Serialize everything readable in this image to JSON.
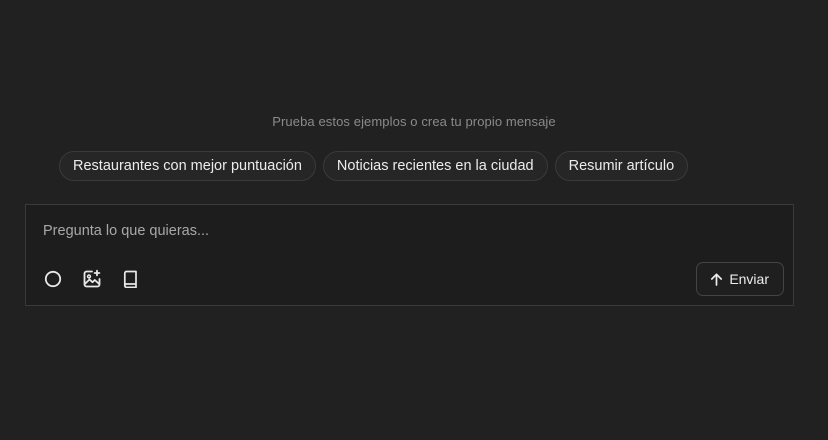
{
  "hint_text": "Prueba estos ejemplos o crea tu propio mensaje",
  "suggestions": [
    {
      "label": "Restaurantes con mejor puntuación"
    },
    {
      "label": "Noticias recientes en la ciudad"
    },
    {
      "label": "Resumir artículo"
    }
  ],
  "composer": {
    "placeholder": "Pregunta lo que quieras...",
    "value": "",
    "tools": [
      {
        "icon": "circle-icon"
      },
      {
        "icon": "image-add-icon"
      },
      {
        "icon": "book-icon"
      }
    ],
    "send_label": "Enviar",
    "send_icon": "arrow-up-icon"
  },
  "colors": {
    "background": "#212121",
    "composer_background": "#1d1d1d",
    "border": "#3a3a3a",
    "text": "#ececec",
    "muted_text": "#8a8a8a"
  }
}
